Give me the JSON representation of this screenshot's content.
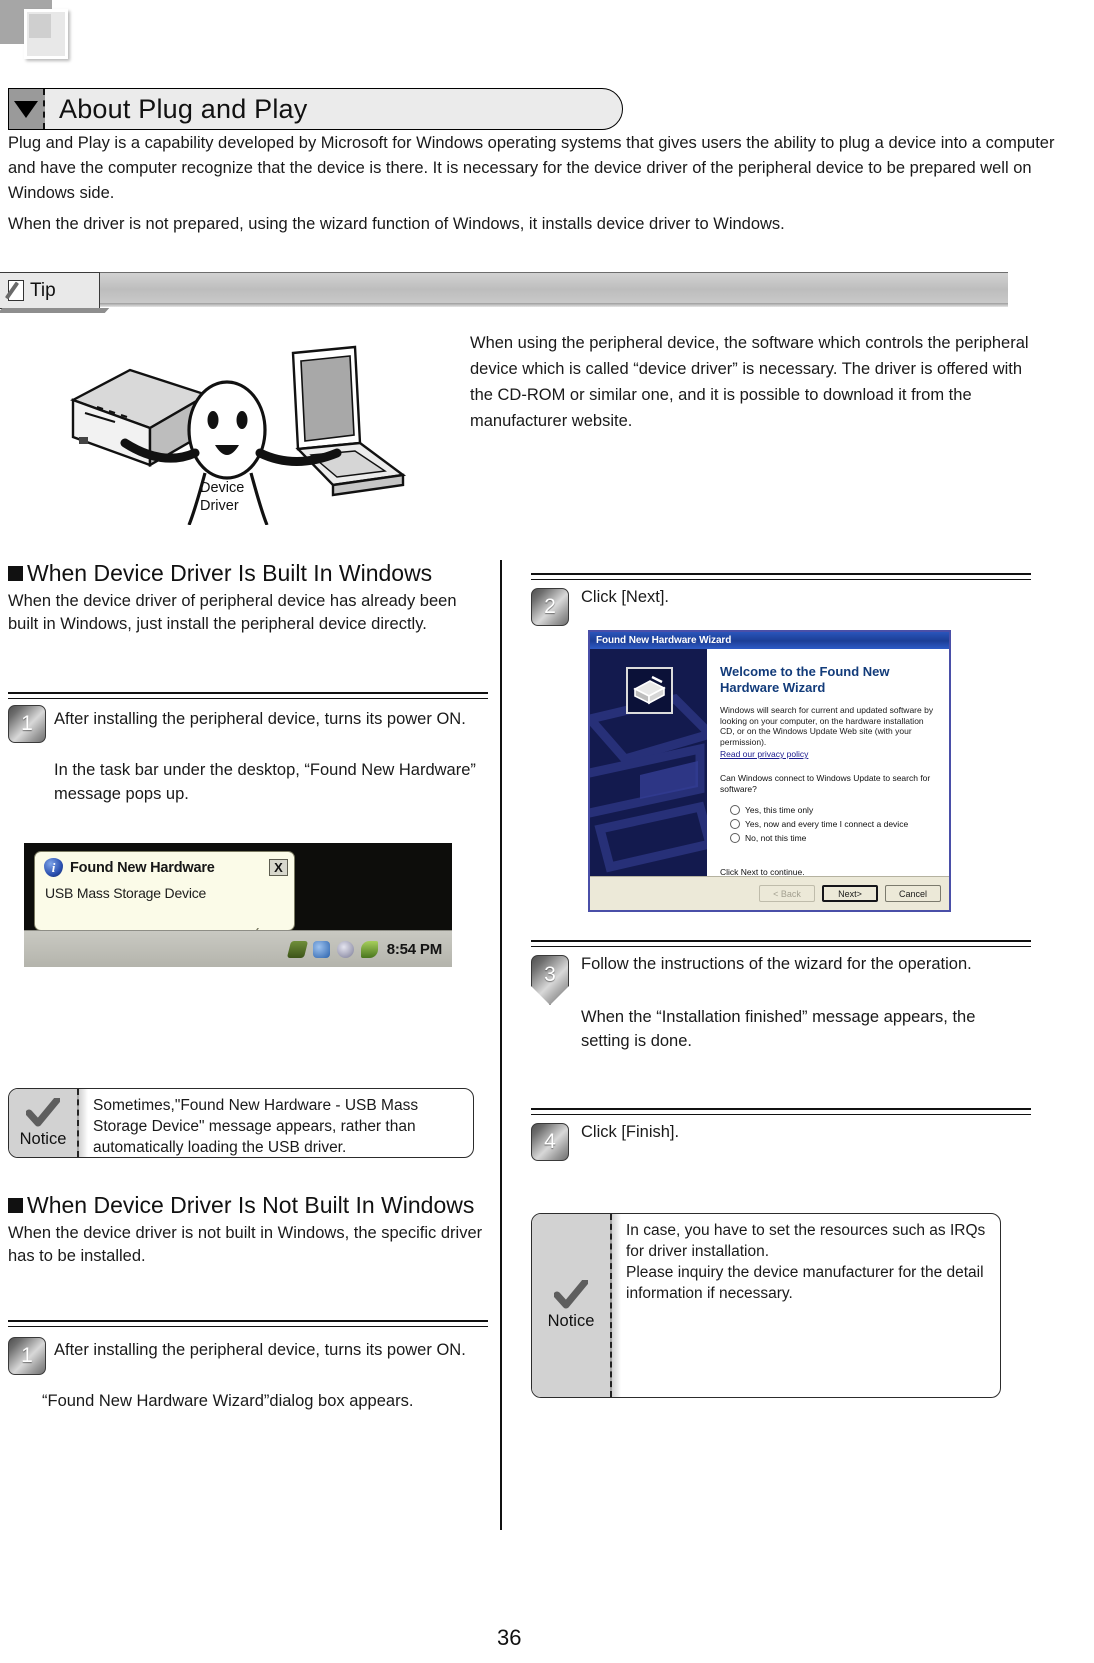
{
  "header": {
    "section_title": "About Plug and Play",
    "arrow_icon": "triangle-down-icon"
  },
  "intro": {
    "paragraph_1": "Plug and Play is a capability developed by Microsoft for Windows operating systems that gives users the ability to plug a device into a computer and have the computer recognize that the device is there. It is necessary for the device driver of the peripheral device to be prepared well on Windows side.",
    "paragraph_2": "When the driver is not prepared, using the wizard function of Windows, it installs device driver to Windows."
  },
  "tip": {
    "label": "Tip",
    "icon": "note-pencil-icon",
    "figure_caption_line1": "Device",
    "figure_caption_line2": "Driver",
    "text": "When using the peripheral device, the software which controls the peripheral device which is called “device driver” is necessary. The driver is offered with the CD-ROM or similar one, and it is possible to download it from the manufacturer website."
  },
  "left_column": {
    "heading_builtin": "When Device Driver Is Built In Windows",
    "para_builtin": "When the device driver of peripheral device has already been built in Windows, just install the peripheral device directly.",
    "step1": {
      "number": "1",
      "text_line1": "After installing the peripheral device, turns its power ON.",
      "text_line2": "In the task bar under the desktop, “Found New Hardware” message pops up."
    },
    "screenshot_found_new_hardware": {
      "balloon_title": "Found New Hardware",
      "balloon_body": "USB Mass Storage Device",
      "close_label": "X",
      "info_icon": "info-icon",
      "taskbar_clock": "8:54 PM"
    },
    "notice": {
      "label": "Notice",
      "icon": "check-mark-icon",
      "text": "Sometimes,\"Found New Hardware - USB Mass Storage Device\" message appears, rather than automatically loading the USB driver."
    },
    "heading_notbuilt": "When Device Driver Is Not Built In Windows",
    "para_notbuilt": "When the device driver is not built in Windows, the specific driver has to be installed.",
    "step1b": {
      "number": "1",
      "text_line1": "After installing the peripheral device, turns its power ON.",
      "text_line2": "“Found New Hardware Wizard”dialog box appears."
    }
  },
  "right_column": {
    "step2": {
      "number": "2",
      "text": "Click [Next]."
    },
    "wizard": {
      "title": "Found New Hardware Wizard",
      "heading": "Welcome to the Found New Hardware Wizard",
      "paragraph": "Windows will search for current and updated software by looking on your computer, on the hardware installation CD, or on the Windows Update Web site (with your permission).",
      "privacy_link": "Read our privacy policy",
      "question": "Can Windows connect to Windows Update to search for software?",
      "options": [
        "Yes, this time only",
        "Yes, now and every time I connect a device",
        "No, not this time"
      ],
      "continue_text": "Click Next to continue.",
      "button_back": "< Back",
      "button_next": "Next>",
      "button_cancel": "Cancel"
    },
    "step3": {
      "number": "3",
      "text_line1": "Follow the instructions of the wizard for the operation.",
      "text_line2": "When the “Installation finished” message appears, the setting is done."
    },
    "step4": {
      "number": "4",
      "text": "Click [Finish]."
    },
    "notice": {
      "label": "Notice",
      "icon": "check-mark-icon",
      "line1": "In case, you have to set the resources such as IRQs for driver installation.",
      "line2": "Please inquiry the device manufacturer for the detail information if necessary."
    }
  },
  "footer": {
    "page_number": "36"
  }
}
